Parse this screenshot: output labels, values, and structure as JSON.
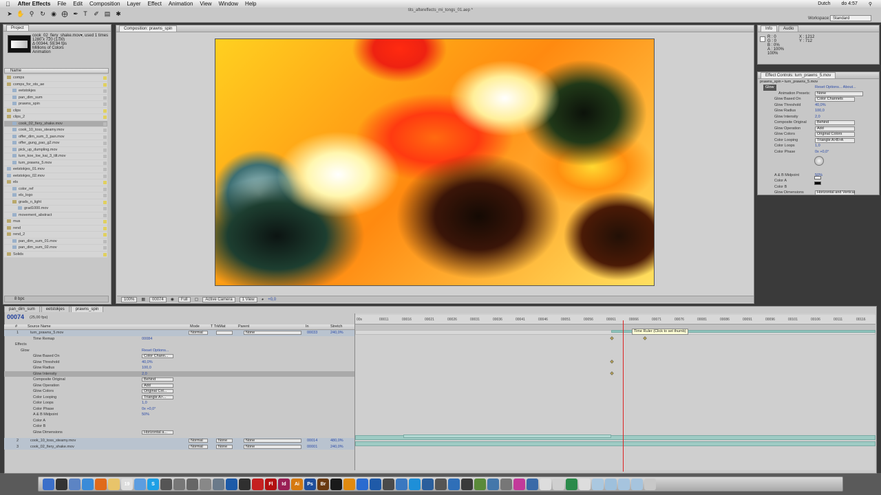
{
  "menubar": {
    "app": "After Effects",
    "items": [
      "File",
      "Edit",
      "Composition",
      "Layer",
      "Effect",
      "Animation",
      "View",
      "Window",
      "Help"
    ],
    "right": [
      "Dutch",
      "do 4:57"
    ]
  },
  "window_title": "tits_aftereffects_mi_tongs_01.aep *",
  "workspace": {
    "label": "Workspace:",
    "value": "Standard"
  },
  "project": {
    "tab": "Project",
    "info_lines": [
      "cook_02_fiery_shake.mov▾, used 1 times",
      "1280 x 720 (1.00)",
      "Δ 00344, 59,94 fps",
      "Millions of Colors",
      "Animation"
    ],
    "col_name": "Name",
    "items": [
      {
        "label": "comps",
        "type": "folder",
        "indent": 0,
        "sel": false
      },
      {
        "label": "comps_for_ots_ae",
        "type": "folder",
        "indent": 0,
        "sel": false
      },
      {
        "label": "eetstokjes",
        "type": "file",
        "indent": 1,
        "sel": false
      },
      {
        "label": "pan_dim_sum",
        "type": "file",
        "indent": 1,
        "sel": false
      },
      {
        "label": "prawns_spin",
        "type": "file",
        "indent": 1,
        "sel": false
      },
      {
        "label": "clips",
        "type": "folder",
        "indent": 0,
        "sel": false
      },
      {
        "label": "clips_2",
        "type": "folder",
        "indent": 0,
        "sel": false
      },
      {
        "label": "cook_02_fiery_shake.mov",
        "type": "file",
        "indent": 1,
        "sel": true
      },
      {
        "label": "cook_10_toss_steamy.mov",
        "type": "file",
        "indent": 1,
        "sel": false
      },
      {
        "label": "offer_dim_sum_3_pan.mov",
        "type": "file",
        "indent": 1,
        "sel": false
      },
      {
        "label": "offer_gung_pao_g2.mov",
        "type": "file",
        "indent": 1,
        "sel": false
      },
      {
        "label": "pick_up_dumpling.mov",
        "type": "file",
        "indent": 1,
        "sel": false
      },
      {
        "label": "turn_koe_loe_kai_3_tilt.mov",
        "type": "file",
        "indent": 1,
        "sel": false
      },
      {
        "label": "turn_prawns_5.mov",
        "type": "file",
        "indent": 1,
        "sel": false
      },
      {
        "label": "eetstokjes_01.mov",
        "type": "file",
        "indent": 0,
        "sel": false
      },
      {
        "label": "eetstokjes_02.mov",
        "type": "file",
        "indent": 0,
        "sel": false
      },
      {
        "label": "els",
        "type": "folder",
        "indent": 0,
        "sel": false
      },
      {
        "label": "color_ref",
        "type": "file",
        "indent": 1,
        "sel": false
      },
      {
        "label": "els_logo",
        "type": "file",
        "indent": 1,
        "sel": false
      },
      {
        "label": "grads_n_light",
        "type": "folder",
        "indent": 1,
        "sel": false
      },
      {
        "label": "grad1000.mov",
        "type": "file",
        "indent": 2,
        "sel": false
      },
      {
        "label": "movement_abstract",
        "type": "file",
        "indent": 1,
        "sel": false
      },
      {
        "label": "mus",
        "type": "folder",
        "indent": 0,
        "sel": false
      },
      {
        "label": "rend",
        "type": "folder",
        "indent": 0,
        "sel": false
      },
      {
        "label": "rend_2",
        "type": "folder",
        "indent": 0,
        "sel": false
      },
      {
        "label": "pan_dim_sum_01.mov",
        "type": "file",
        "indent": 1,
        "sel": false
      },
      {
        "label": "pan_dim_sum_02.mov",
        "type": "file",
        "indent": 1,
        "sel": false
      },
      {
        "label": "Solids",
        "type": "folder",
        "indent": 0,
        "sel": false
      }
    ],
    "footer_bpc": "8 bpc"
  },
  "composition": {
    "tab": "Composition: prawns_spin",
    "zoom": "100%",
    "timecode": "00074",
    "resolution": "Full",
    "camera": "Active Camera",
    "views": "1 View",
    "exposure": "+0,0"
  },
  "info": {
    "tabs": [
      "Info",
      "Audio"
    ],
    "r": "R : 0",
    "g": "G : 0",
    "b": "B : 0%",
    "a": "A : 100%",
    "extra": "100%",
    "x": "X : 1212",
    "y": "Y : 712"
  },
  "effect_controls": {
    "tab": "Effect Controls: turn_prawns_5.mov",
    "source": "prawns_spin • turn_prawns_5.mov",
    "effect": "Glow",
    "reset": "Reset  Options...  About...",
    "presets_label": "Animation Presets:",
    "presets_value": "None",
    "rows": [
      {
        "label": "Glow Based On",
        "value": "Color Channels",
        "dd": true
      },
      {
        "label": "Glow Threshold",
        "value": "40,0%",
        "dd": false
      },
      {
        "label": "Glow Radius",
        "value": "100,0",
        "dd": false
      },
      {
        "label": "Glow Intensity",
        "value": "2,0",
        "dd": false
      },
      {
        "label": "Composite Original",
        "value": "Behind",
        "dd": true
      },
      {
        "label": "Glow Operation",
        "value": "Add",
        "dd": true
      },
      {
        "label": "Glow Colors",
        "value": "Original Colors",
        "dd": true
      },
      {
        "label": "Color Looping",
        "value": "Triangle A>B>A",
        "dd": true
      },
      {
        "label": "Color Loops",
        "value": "1,0",
        "dd": false
      },
      {
        "label": "Color Phase",
        "value": "0x +0,0°",
        "dd": false
      },
      {
        "label": "",
        "value": "",
        "dd": false
      },
      {
        "label": "",
        "value": "",
        "dd": false
      },
      {
        "label": "",
        "value": "",
        "dd": false
      },
      {
        "label": "A & B Midpoint",
        "value": "50%",
        "dd": false
      },
      {
        "label": "Color A",
        "value": "",
        "dd": false
      },
      {
        "label": "Color B",
        "value": "",
        "dd": false
      },
      {
        "label": "Glow Dimensions",
        "value": "Horizontal and Vertical",
        "dd": true
      }
    ]
  },
  "timeline": {
    "tabs": [
      "pan_dim_sum",
      "eetstokjes",
      "prawns_spin"
    ],
    "timecode": "00074",
    "fps": "(25,00 fps)",
    "headers": {
      "num": "#",
      "source": "Source Name",
      "mode": "Mode",
      "trkmat": "T  TrkMat",
      "parent": "Parent",
      "in": "In",
      "stretch": "Stretch"
    },
    "ruler_ticks": [
      "00s",
      "00011",
      "00016",
      "00021",
      "00026",
      "00031",
      "00036",
      "00041",
      "00046",
      "00051",
      "00056",
      "00061",
      "00066",
      "00071",
      "00076",
      "00081",
      "00086",
      "00091",
      "00096",
      "00101",
      "00106",
      "00111",
      "00116"
    ],
    "tooltip": "Time Ruler (Click to set thumb)",
    "layers": [
      {
        "num": "1",
        "name": "turn_prawns_5.mov",
        "mode": "Normal",
        "trkmat": "",
        "parent": "None",
        "in": "00033",
        "stretch": "240,0%"
      },
      {
        "num": "2",
        "name": "cook_10_toss_steamy.mov",
        "mode": "Normal",
        "trkmat": "None",
        "parent": "None",
        "in": "00014",
        "stretch": "480,0%"
      },
      {
        "num": "3",
        "name": "cook_02_fiery_shake.mov",
        "mode": "Normal",
        "trkmat": "None",
        "parent": "None",
        "in": "00001",
        "stretch": "240,0%"
      }
    ],
    "props": [
      {
        "label": "Time Remap",
        "value": "00084",
        "dd": false
      },
      {
        "label": "Effects",
        "value": "",
        "dd": false
      },
      {
        "label": "Glow",
        "value": "Reset  Options...",
        "dd": false
      },
      {
        "label": "Glow Based On",
        "value": "Color Chann...",
        "dd": true
      },
      {
        "label": "Glow Threshold",
        "value": "40,0%",
        "dd": false
      },
      {
        "label": "Glow Radius",
        "value": "100,0",
        "dd": false
      },
      {
        "label": "Glow Intensity",
        "value": "2,0",
        "dd": false
      },
      {
        "label": "Composite Original",
        "value": "Behind",
        "dd": true
      },
      {
        "label": "Glow Operation",
        "value": "Add",
        "dd": true
      },
      {
        "label": "Glow Colors",
        "value": "Original Col...",
        "dd": true
      },
      {
        "label": "Color Looping",
        "value": "Triangle A>...",
        "dd": true
      },
      {
        "label": "Color Loops",
        "value": "1,0",
        "dd": false
      },
      {
        "label": "Color Phase",
        "value": "0x +0,0°",
        "dd": false
      },
      {
        "label": "A & B Midpoint",
        "value": "50%",
        "dd": false
      },
      {
        "label": "Color A",
        "value": "",
        "dd": false
      },
      {
        "label": "Color B",
        "value": "",
        "dd": false
      },
      {
        "label": "Glow Dimensions",
        "value": "Horizontal a...",
        "dd": true
      }
    ]
  },
  "dock": {
    "apps": [
      {
        "name": "finder-icon",
        "color": "#3b6fc9",
        "t": ""
      },
      {
        "name": "dashboard-icon",
        "color": "#333",
        "t": ""
      },
      {
        "name": "mail-icon",
        "color": "#5c84c4",
        "t": ""
      },
      {
        "name": "safari-icon",
        "color": "#3a8bd8",
        "t": ""
      },
      {
        "name": "firefox-icon",
        "color": "#e06a1a",
        "t": ""
      },
      {
        "name": "notes-icon",
        "color": "#e8c46a",
        "t": ""
      },
      {
        "name": "ical-icon",
        "color": "#ddd",
        "t": "19"
      },
      {
        "name": "ichat-icon",
        "color": "#5c9de0",
        "t": ""
      },
      {
        "name": "skype-icon",
        "color": "#1ea0e6",
        "t": "S"
      },
      {
        "name": "itunes-icon",
        "color": "#555",
        "t": ""
      },
      {
        "name": "app-icon-10",
        "color": "#777",
        "t": ""
      },
      {
        "name": "app-icon-11",
        "color": "#666",
        "t": ""
      },
      {
        "name": "app-icon-12",
        "color": "#888",
        "t": ""
      },
      {
        "name": "app-icon-13",
        "color": "#6a7a8a",
        "t": ""
      },
      {
        "name": "app-icon-14",
        "color": "#1c5aa8",
        "t": ""
      },
      {
        "name": "app-icon-15",
        "color": "#2f2f2f",
        "t": ""
      },
      {
        "name": "acrobat-icon",
        "color": "#c52020",
        "t": ""
      },
      {
        "name": "flash-icon",
        "color": "#b31010",
        "t": "Fl"
      },
      {
        "name": "indesign-icon",
        "color": "#9a1f55",
        "t": "Id"
      },
      {
        "name": "illustrator-icon",
        "color": "#d67a10",
        "t": "Ai"
      },
      {
        "name": "photoshop-icon",
        "color": "#1f4e9c",
        "t": "Ps"
      },
      {
        "name": "bridge-icon",
        "color": "#6a3a12",
        "t": "Br"
      },
      {
        "name": "app-icon-22",
        "color": "#1a1a1a",
        "t": ""
      },
      {
        "name": "vlc-icon",
        "color": "#e08a10",
        "t": ""
      },
      {
        "name": "app-icon-24",
        "color": "#2a6bd0",
        "t": ""
      },
      {
        "name": "app-icon-25",
        "color": "#1f5aa8",
        "t": ""
      },
      {
        "name": "app-icon-26",
        "color": "#4a4a4a",
        "t": ""
      },
      {
        "name": "app-icon-27",
        "color": "#3a78c0",
        "t": ""
      },
      {
        "name": "app-icon-28",
        "color": "#1e8fd8",
        "t": ""
      },
      {
        "name": "app-icon-29",
        "color": "#2a5e9c",
        "t": ""
      },
      {
        "name": "app-icon-30",
        "color": "#555",
        "t": ""
      },
      {
        "name": "app-icon-31",
        "color": "#2f6fb8",
        "t": ""
      },
      {
        "name": "app-icon-32",
        "color": "#3a3a3a",
        "t": ""
      },
      {
        "name": "app-icon-33",
        "color": "#5a8a3a",
        "t": ""
      },
      {
        "name": "app-icon-34",
        "color": "#4477aa",
        "t": ""
      },
      {
        "name": "app-icon-35",
        "color": "#777",
        "t": ""
      },
      {
        "name": "app-icon-36",
        "color": "#c23a9a",
        "t": ""
      },
      {
        "name": "app-icon-37",
        "color": "#3a6aa8",
        "t": ""
      },
      {
        "name": "app-icon-38",
        "color": "#ddd",
        "t": ""
      },
      {
        "name": "app-icon-39",
        "color": "#cfcfcf",
        "t": ""
      },
      {
        "name": "app-icon-40",
        "color": "#2a8a4a",
        "t": ""
      },
      {
        "name": "app-icon-41",
        "color": "#ddd",
        "t": ""
      },
      {
        "name": "app-icon-42",
        "color": "#aac8e0",
        "t": ""
      },
      {
        "name": "app-icon-43",
        "color": "#9ec0dc",
        "t": ""
      },
      {
        "name": "app-icon-44",
        "color": "#a6c4de",
        "t": ""
      },
      {
        "name": "app-icon-45",
        "color": "#a6c4de",
        "t": ""
      },
      {
        "name": "trash-icon",
        "color": "#c8c8c8",
        "t": ""
      }
    ]
  }
}
